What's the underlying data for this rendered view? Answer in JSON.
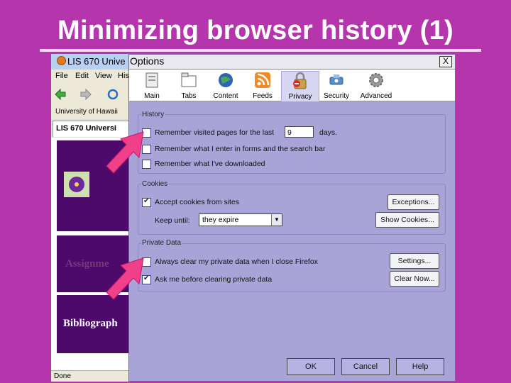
{
  "slide": {
    "title": "Minimizing browser history (1)"
  },
  "browser": {
    "window_title": "LIS 670 Unive",
    "menu": [
      "File",
      "Edit",
      "View",
      "His"
    ],
    "bookmark": "University of Hawaii",
    "tab": "LIS 670 Universi",
    "content_links": [
      "Assignme",
      "Bibliograph"
    ],
    "status": "Done"
  },
  "dialog": {
    "title": "Options",
    "close_label": "X",
    "toolbar": [
      {
        "label": "Main",
        "icon": "main-icon"
      },
      {
        "label": "Tabs",
        "icon": "tabs-icon"
      },
      {
        "label": "Content",
        "icon": "content-icon"
      },
      {
        "label": "Feeds",
        "icon": "feeds-icon"
      },
      {
        "label": "Privacy",
        "icon": "privacy-icon",
        "selected": true
      },
      {
        "label": "Security",
        "icon": "security-icon"
      },
      {
        "label": "Advanced",
        "icon": "advanced-icon"
      }
    ],
    "history": {
      "label": "History",
      "remember_visited_before": "Remember visited pages for the last",
      "days_value": "9",
      "remember_visited_after": "days.",
      "remember_forms": "Remember what I enter in forms and the search bar",
      "remember_downloads": "Remember what I've downloaded"
    },
    "cookies": {
      "label": "Cookies",
      "accept": "Accept cookies from sites",
      "keep_until_label": "Keep until:",
      "keep_until_value": "they expire",
      "exceptions_button": "Exceptions...",
      "show_cookies_button": "Show Cookies..."
    },
    "private_data": {
      "label": "Private Data",
      "always_clear": "Always clear my private data when I close Firefox",
      "ask_before": "Ask me before clearing private data",
      "settings_button": "Settings...",
      "clear_now_button": "Clear Now..."
    },
    "buttons": {
      "ok": "OK",
      "cancel": "Cancel",
      "help": "Help"
    }
  },
  "colors": {
    "slide_bg": "#b536ac",
    "dialog_bg": "#a8a4d8",
    "arrow": "#f0408a",
    "site_purple": "#4d0a6b"
  }
}
